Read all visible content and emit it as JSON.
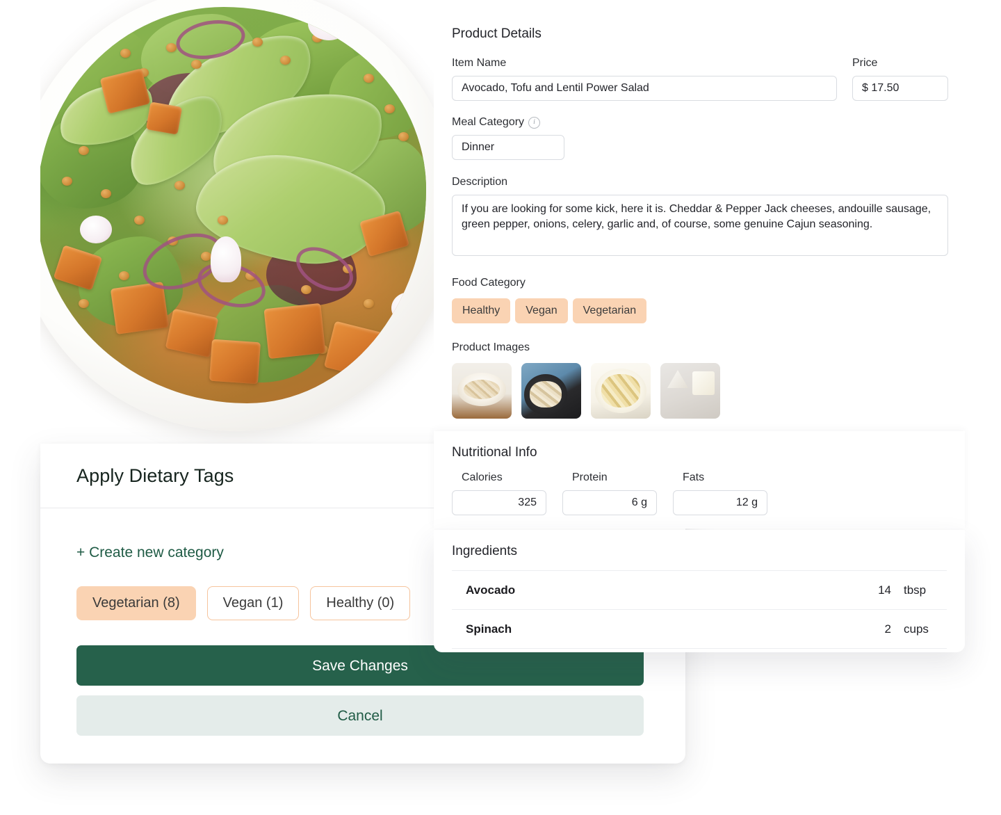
{
  "photo": {
    "alt_name": "avocado-tofu-lentil-salad-photo"
  },
  "product_details": {
    "section_title": "Product Details",
    "item_name": {
      "label": "Item Name",
      "value": "Avocado, Tofu and Lentil Power Salad",
      "placeholder": "Item Name"
    },
    "price": {
      "label": "Price",
      "value": "$ 17.50",
      "placeholder": "$ 0.00"
    },
    "meal_category": {
      "label": "Meal Category",
      "value": "Dinner",
      "placeholder": "Select meal",
      "info_icon": "info-icon"
    },
    "description": {
      "label": "Description",
      "value": "If you are looking for some kick, here it is. Cheddar & Pepper Jack cheeses, andouille sausage, green pepper, onions, celery, garlic and, of course, some genuine Cajun seasoning.",
      "placeholder": "Description"
    },
    "food_category": {
      "label": "Food Category",
      "tags": [
        "Healthy",
        "Vegan",
        "Vegetarian"
      ]
    },
    "product_images": {
      "label": "Product Images",
      "thumbnails": [
        {
          "name": "thumbnail-rice-bowl"
        },
        {
          "name": "thumbnail-skillet-pasta"
        },
        {
          "name": "thumbnail-penne-bowl"
        },
        {
          "name": "thumbnail-cheese-board"
        }
      ]
    }
  },
  "nutritional_info": {
    "section_title": "Nutritional Info",
    "fields": [
      {
        "label": "Calories",
        "value": "325"
      },
      {
        "label": "Protein",
        "value": "6 g"
      },
      {
        "label": "Fats",
        "value": "12 g"
      }
    ]
  },
  "ingredients": {
    "section_title": "Ingredients",
    "rows": [
      {
        "name": "Avocado",
        "quantity": "14",
        "unit": "tbsp"
      },
      {
        "name": "Spinach",
        "quantity": "2",
        "unit": "cups"
      }
    ]
  },
  "dietary_tags_panel": {
    "title": "Apply Dietary Tags",
    "create_link": "+ Create new category",
    "chips": [
      {
        "label": "Vegetarian (8)",
        "selected": true
      },
      {
        "label": "Vegan (1)",
        "selected": false
      },
      {
        "label": "Healthy (0)",
        "selected": false
      }
    ],
    "save_label": "Save Changes",
    "cancel_label": "Cancel"
  },
  "colors": {
    "primary_green": "#26614b",
    "secondary_green_bg": "#e4ecea",
    "link_green": "#1f5b45",
    "tag_peach": "#fad3b3",
    "tag_border": "#f6c49d",
    "input_border": "#d9dce1"
  }
}
